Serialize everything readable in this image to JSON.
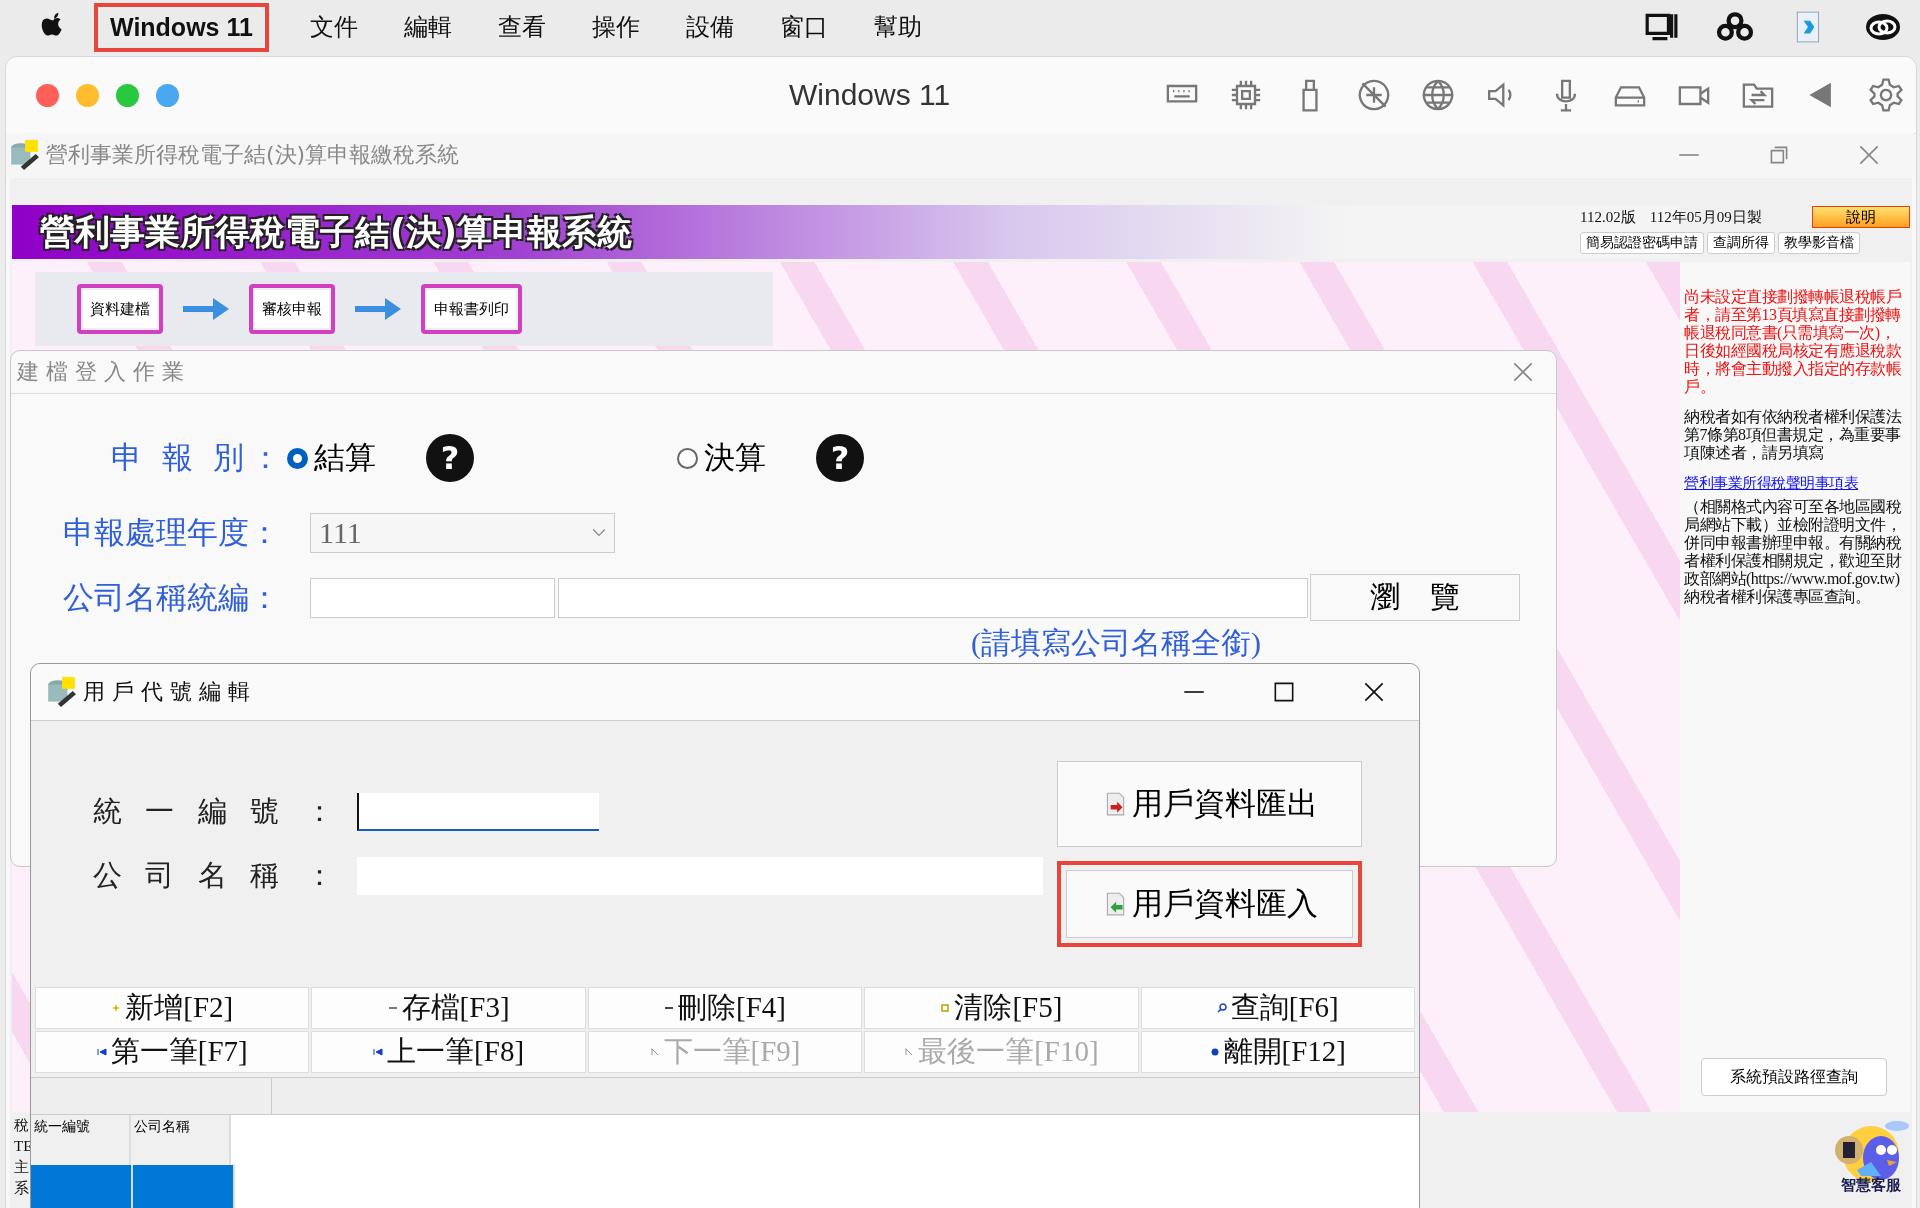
{
  "menubar": {
    "app": "Windows 11",
    "app_highlighted": true,
    "menus": [
      "文件",
      "編輯",
      "查看",
      "操作",
      "設備",
      "窗口",
      "幫助"
    ]
  },
  "vm_window": {
    "title": "Windows 11"
  },
  "app_window": {
    "title": "營利事業所得稅電子結(決)算申報繳稅系統"
  },
  "banner": {
    "title": "營利事業所得稅電子結(決)算申報系統",
    "version": "112.02版",
    "build_date": "112年05月09日製",
    "help_button": "說明",
    "links": [
      "簡易認證密碼申請",
      "查調所得",
      "教學影音檔"
    ]
  },
  "steps": [
    "資料建檔",
    "審核申報",
    "申報書列印"
  ],
  "side_notes": {
    "warning": "尚未設定直接劃撥轉帳退稅帳戶者，請至第13頁填寫直接劃撥轉帳退稅同意書(只需填寫一次)，日後如經國稅局核定有應退稅款時，將會主動撥入指定的存款帳戶。",
    "notice": "納稅者如有依納稅者權利保護法第7條第8項但書規定，為重要事項陳述者，請另填寫",
    "link": "營利事業所得稅聲明事項表",
    "detail": "（相關格式內容可至各地區國稅局網站下載）並檢附證明文件，併同申報書辦理申報。有關納稅者權利保護相關規定，歡迎至財政部網站(https://www.mof.gov.tw)納稅者權利保護專區查詢。"
  },
  "path_button": "系統預設路徑查詢",
  "assistant": {
    "label": "智慧客服"
  },
  "left_fragments": [
    "稅",
    "TE",
    "主",
    "系"
  ],
  "login_dialog": {
    "title": "建 檔 登 入 作 業",
    "type_label": "申 報 別：",
    "types": [
      {
        "label": "結算",
        "selected": true
      },
      {
        "label": "決算",
        "selected": false
      }
    ],
    "help_mark": "?",
    "year_label": "申報處理年度：",
    "year": "111",
    "company_label": "公司名稱統編：",
    "browse_button": "瀏　覽",
    "hint": "(請填寫公司名稱全銜)"
  },
  "user_dialog": {
    "title": "用 戶 代 號 編 輯",
    "fields": [
      {
        "label": "統 一 編 號",
        "colon": "：",
        "focused": true
      },
      {
        "label": "公 司 名 稱",
        "colon": "：",
        "focused": false
      }
    ],
    "side_buttons": [
      {
        "label": "用戶資料匯出",
        "kind": "export",
        "highlighted": false
      },
      {
        "label": "用戶資料匯入",
        "kind": "import",
        "highlighted": true
      }
    ],
    "tools": [
      {
        "label": "新增[F2]",
        "kind": "add",
        "disabled": false
      },
      {
        "label": "存檔[F3]",
        "kind": "save",
        "disabled": false
      },
      {
        "label": "刪除[F4]",
        "kind": "delete",
        "disabled": false
      },
      {
        "label": "清除[F5]",
        "kind": "clear",
        "disabled": false
      },
      {
        "label": "查詢[F6]",
        "kind": "query",
        "disabled": false
      },
      {
        "label": "第一筆[F7]",
        "kind": "first",
        "disabled": false
      },
      {
        "label": "上一筆[F8]",
        "kind": "prev",
        "disabled": false
      },
      {
        "label": "下一筆[F9]",
        "kind": "next",
        "disabled": true
      },
      {
        "label": "最後一筆[F10]",
        "kind": "last",
        "disabled": true
      },
      {
        "label": "離開[F12]",
        "kind": "exit",
        "disabled": false
      }
    ],
    "grid": {
      "columns": [
        "統一編號",
        "公司名稱"
      ],
      "rows": [
        {
          "selected": true
        }
      ]
    }
  }
}
